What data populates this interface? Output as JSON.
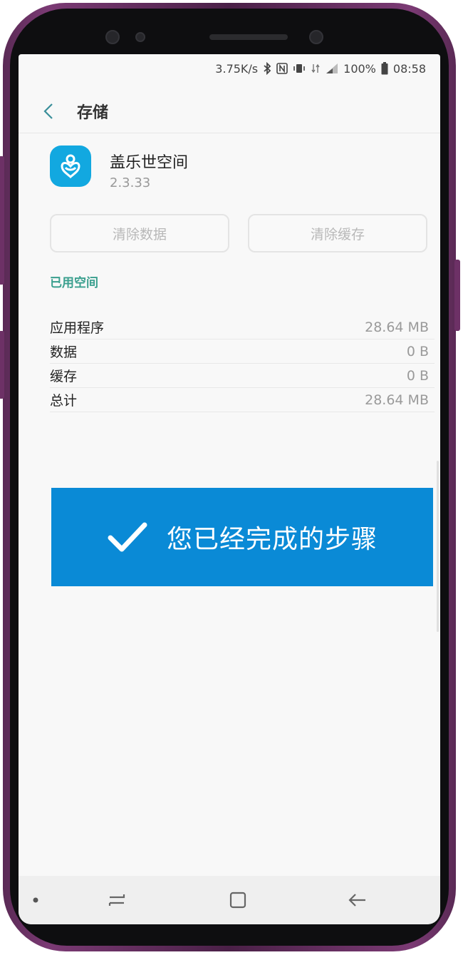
{
  "status_bar": {
    "network_speed": "3.75K/s",
    "battery": "100%",
    "time": "08:58"
  },
  "header": {
    "title": "存储"
  },
  "app": {
    "name": "盖乐世空间",
    "version": "2.3.33",
    "icon_color": "#12a8e0"
  },
  "buttons": {
    "clear_data": "清除数据",
    "clear_cache": "清除缓存"
  },
  "section": {
    "title": "已用空间"
  },
  "storage_rows": [
    {
      "label": "应用程序",
      "value": "28.64 MB"
    },
    {
      "label": "数据",
      "value": "0 B"
    },
    {
      "label": "缓存",
      "value": "0 B"
    },
    {
      "label": "总计",
      "value": "28.64 MB"
    }
  ],
  "banner": {
    "text": "您已经完成的步骤",
    "color": "#0a8ad6"
  },
  "colors": {
    "accent": "#3a9f8e",
    "phone_frame": "#7b3a74"
  }
}
